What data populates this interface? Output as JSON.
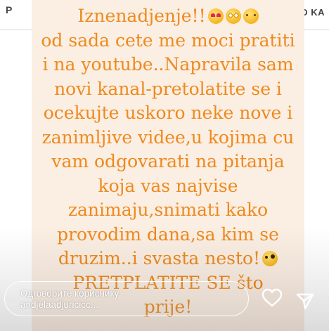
{
  "topbar": {
    "left_tab": "P",
    "right_tab": "O KA"
  },
  "story": {
    "lines": [
      "Iznenadjenje!!",
      "od sada cete me moci pratiti",
      "i na youtube..Napravila sam",
      "novi kanal-pretolatite se i",
      "ocekujte uskoro neke nove i",
      "zanimljive videe,u kojima cu",
      "vam odgovarati na pitanja",
      "koja vas najvise",
      "zanimaju,snimati kako",
      "provodim dana,sa kim se",
      "druzim..i svasta nesto!",
      "PRETPLATITE SE što",
      "prije!"
    ],
    "emojis": [
      "heart-eyes-emoji",
      "star-struck-emoji",
      "partying-face-emoji",
      "zany-face-emoji"
    ],
    "colors": {
      "text": "#ee8a1e",
      "background": "#fbeee3"
    }
  },
  "reply": {
    "line1": "Одговорите кориснику",
    "line2": "andjelaadjuricicc..."
  },
  "actions": {
    "like_icon": "heart-icon",
    "share_icon": "send-icon"
  }
}
